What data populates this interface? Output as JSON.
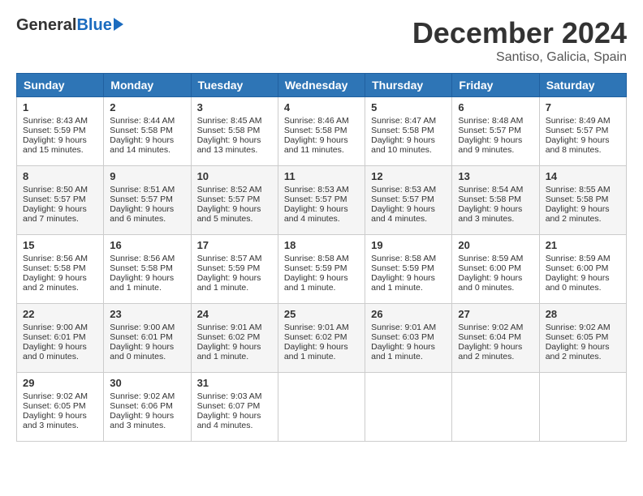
{
  "header": {
    "logo_general": "General",
    "logo_blue": "Blue",
    "month_title": "December 2024",
    "location": "Santiso, Galicia, Spain"
  },
  "weekdays": [
    "Sunday",
    "Monday",
    "Tuesday",
    "Wednesday",
    "Thursday",
    "Friday",
    "Saturday"
  ],
  "weeks": [
    [
      {
        "day": "1",
        "sunrise": "8:43 AM",
        "sunset": "5:59 PM",
        "daylight": "9 hours and 15 minutes."
      },
      {
        "day": "2",
        "sunrise": "8:44 AM",
        "sunset": "5:58 PM",
        "daylight": "9 hours and 14 minutes."
      },
      {
        "day": "3",
        "sunrise": "8:45 AM",
        "sunset": "5:58 PM",
        "daylight": "9 hours and 13 minutes."
      },
      {
        "day": "4",
        "sunrise": "8:46 AM",
        "sunset": "5:58 PM",
        "daylight": "9 hours and 11 minutes."
      },
      {
        "day": "5",
        "sunrise": "8:47 AM",
        "sunset": "5:58 PM",
        "daylight": "9 hours and 10 minutes."
      },
      {
        "day": "6",
        "sunrise": "8:48 AM",
        "sunset": "5:57 PM",
        "daylight": "9 hours and 9 minutes."
      },
      {
        "day": "7",
        "sunrise": "8:49 AM",
        "sunset": "5:57 PM",
        "daylight": "9 hours and 8 minutes."
      }
    ],
    [
      {
        "day": "8",
        "sunrise": "8:50 AM",
        "sunset": "5:57 PM",
        "daylight": "9 hours and 7 minutes."
      },
      {
        "day": "9",
        "sunrise": "8:51 AM",
        "sunset": "5:57 PM",
        "daylight": "9 hours and 6 minutes."
      },
      {
        "day": "10",
        "sunrise": "8:52 AM",
        "sunset": "5:57 PM",
        "daylight": "9 hours and 5 minutes."
      },
      {
        "day": "11",
        "sunrise": "8:53 AM",
        "sunset": "5:57 PM",
        "daylight": "9 hours and 4 minutes."
      },
      {
        "day": "12",
        "sunrise": "8:53 AM",
        "sunset": "5:57 PM",
        "daylight": "9 hours and 4 minutes."
      },
      {
        "day": "13",
        "sunrise": "8:54 AM",
        "sunset": "5:58 PM",
        "daylight": "9 hours and 3 minutes."
      },
      {
        "day": "14",
        "sunrise": "8:55 AM",
        "sunset": "5:58 PM",
        "daylight": "9 hours and 2 minutes."
      }
    ],
    [
      {
        "day": "15",
        "sunrise": "8:56 AM",
        "sunset": "5:58 PM",
        "daylight": "9 hours and 2 minutes."
      },
      {
        "day": "16",
        "sunrise": "8:56 AM",
        "sunset": "5:58 PM",
        "daylight": "9 hours and 1 minute."
      },
      {
        "day": "17",
        "sunrise": "8:57 AM",
        "sunset": "5:59 PM",
        "daylight": "9 hours and 1 minute."
      },
      {
        "day": "18",
        "sunrise": "8:58 AM",
        "sunset": "5:59 PM",
        "daylight": "9 hours and 1 minute."
      },
      {
        "day": "19",
        "sunrise": "8:58 AM",
        "sunset": "5:59 PM",
        "daylight": "9 hours and 1 minute."
      },
      {
        "day": "20",
        "sunrise": "8:59 AM",
        "sunset": "6:00 PM",
        "daylight": "9 hours and 0 minutes."
      },
      {
        "day": "21",
        "sunrise": "8:59 AM",
        "sunset": "6:00 PM",
        "daylight": "9 hours and 0 minutes."
      }
    ],
    [
      {
        "day": "22",
        "sunrise": "9:00 AM",
        "sunset": "6:01 PM",
        "daylight": "9 hours and 0 minutes."
      },
      {
        "day": "23",
        "sunrise": "9:00 AM",
        "sunset": "6:01 PM",
        "daylight": "9 hours and 0 minutes."
      },
      {
        "day": "24",
        "sunrise": "9:01 AM",
        "sunset": "6:02 PM",
        "daylight": "9 hours and 1 minute."
      },
      {
        "day": "25",
        "sunrise": "9:01 AM",
        "sunset": "6:02 PM",
        "daylight": "9 hours and 1 minute."
      },
      {
        "day": "26",
        "sunrise": "9:01 AM",
        "sunset": "6:03 PM",
        "daylight": "9 hours and 1 minute."
      },
      {
        "day": "27",
        "sunrise": "9:02 AM",
        "sunset": "6:04 PM",
        "daylight": "9 hours and 2 minutes."
      },
      {
        "day": "28",
        "sunrise": "9:02 AM",
        "sunset": "6:05 PM",
        "daylight": "9 hours and 2 minutes."
      }
    ],
    [
      {
        "day": "29",
        "sunrise": "9:02 AM",
        "sunset": "6:05 PM",
        "daylight": "9 hours and 3 minutes."
      },
      {
        "day": "30",
        "sunrise": "9:02 AM",
        "sunset": "6:06 PM",
        "daylight": "9 hours and 3 minutes."
      },
      {
        "day": "31",
        "sunrise": "9:03 AM",
        "sunset": "6:07 PM",
        "daylight": "9 hours and 4 minutes."
      },
      null,
      null,
      null,
      null
    ]
  ]
}
